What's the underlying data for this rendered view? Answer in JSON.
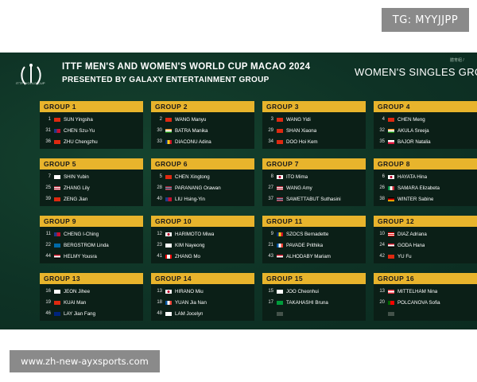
{
  "watermark": {
    "tg": "TG: MYYJJPP",
    "url": "www.zh-new-ayxsports.com"
  },
  "header": {
    "logo_text": "ITTF WORLD CUP",
    "title_line1": "ITTF MEN'S AND WOMEN'S WORLD CUP MACAO 2024",
    "title_line2": "PRESENTED BY GALAXY ENTERTAINMENT GROUP",
    "event_title": "WOMEN'S SINGLES GRO",
    "small_tag": "體育組 / "
  },
  "colors": {
    "header_gold": "#e8b42c",
    "background": "#0f3528",
    "panel": "#0b1f17"
  },
  "groups": [
    {
      "label": "GROUP 1",
      "players": [
        {
          "seed": "1",
          "flag": "china-flag",
          "name": "SUN Yingsha"
        },
        {
          "seed": "31",
          "flag": "chinese-taipei-flag",
          "name": "CHEN Szu-Yu"
        },
        {
          "seed": "36",
          "flag": "china-flag",
          "name": "ZHU Chengzhu"
        }
      ]
    },
    {
      "label": "GROUP 2",
      "players": [
        {
          "seed": "2",
          "flag": "china-flag",
          "name": "WANG Manyu"
        },
        {
          "seed": "30",
          "flag": "india-flag",
          "name": "BATRA Manika"
        },
        {
          "seed": "33",
          "flag": "romania-flag",
          "name": "DIACONU Adina"
        }
      ]
    },
    {
      "label": "GROUP 3",
      "players": [
        {
          "seed": "3",
          "flag": "china-flag",
          "name": "WANG Yidi"
        },
        {
          "seed": "29",
          "flag": "china-flag",
          "name": "SHAN Xiaona"
        },
        {
          "seed": "34",
          "flag": "hong-kong-flag",
          "name": "DOO Hoi Kem"
        }
      ]
    },
    {
      "label": "GROUP 4",
      "players": [
        {
          "seed": "4",
          "flag": "china-flag",
          "name": "CHEN Meng"
        },
        {
          "seed": "32",
          "flag": "india-flag",
          "name": "AKULA Sreeja"
        },
        {
          "seed": "35",
          "flag": "poland-flag",
          "name": "BAJOR Natalia"
        }
      ]
    },
    {
      "label": "GROUP 5",
      "players": [
        {
          "seed": "7",
          "flag": "korea-flag",
          "name": "SHIN Yubin"
        },
        {
          "seed": "25",
          "flag": "usa-flag",
          "name": "ZHANG Lily"
        },
        {
          "seed": "39",
          "flag": "china-flag",
          "name": "ZENG Jian"
        }
      ]
    },
    {
      "label": "GROUP 6",
      "players": [
        {
          "seed": "5",
          "flag": "china-flag",
          "name": "CHEN Xingtong"
        },
        {
          "seed": "28",
          "flag": "thailand-flag",
          "name": "PARANANG Orawan"
        },
        {
          "seed": "40",
          "flag": "chinese-taipei-flag",
          "name": "LIU Hsing-Yin"
        }
      ]
    },
    {
      "label": "GROUP 7",
      "players": [
        {
          "seed": "8",
          "flag": "japan-flag",
          "name": "ITO Mima"
        },
        {
          "seed": "27",
          "flag": "usa-flag",
          "name": "WANG Amy"
        },
        {
          "seed": "37",
          "flag": "thailand-flag",
          "name": "SAWETTABUT Suthasini"
        }
      ]
    },
    {
      "label": "GROUP 8",
      "players": [
        {
          "seed": "6",
          "flag": "japan-flag",
          "name": "HAYATA Hina"
        },
        {
          "seed": "26",
          "flag": "italy-flag",
          "name": "SAMARA Elizabeta"
        },
        {
          "seed": "38",
          "flag": "germany-flag",
          "name": "WINTER Sabine"
        }
      ]
    },
    {
      "label": "GROUP 9",
      "players": [
        {
          "seed": "11",
          "flag": "chinese-taipei-flag",
          "name": "CHENG I-Ching"
        },
        {
          "seed": "22",
          "flag": "sweden-flag",
          "name": "BERGSTROM Linda"
        },
        {
          "seed": "44",
          "flag": "egypt-flag",
          "name": "HELMY Yousra"
        }
      ]
    },
    {
      "label": "GROUP 10",
      "players": [
        {
          "seed": "12",
          "flag": "japan-flag",
          "name": "HARIMOTO Miwa"
        },
        {
          "seed": "23",
          "flag": "korea-flag",
          "name": "KIM Nayeong"
        },
        {
          "seed": "41",
          "flag": "canada-flag",
          "name": "ZHANG Mo"
        }
      ]
    },
    {
      "label": "GROUP 11",
      "players": [
        {
          "seed": "9",
          "flag": "romania-flag",
          "name": "SZOCS Bernadette"
        },
        {
          "seed": "21",
          "flag": "france-flag",
          "name": "PAVADE Prithika"
        },
        {
          "seed": "43",
          "flag": "egypt-flag",
          "name": "ALHODABY Mariam"
        }
      ]
    },
    {
      "label": "GROUP 12",
      "players": [
        {
          "seed": "10",
          "flag": "puerto-rico-flag",
          "name": "DIAZ Adriana"
        },
        {
          "seed": "24",
          "flag": "egypt-flag",
          "name": "GODA Hana"
        },
        {
          "seed": "42",
          "flag": "china-flag",
          "name": "YU Fu"
        }
      ]
    },
    {
      "label": "GROUP 13",
      "players": [
        {
          "seed": "16",
          "flag": "korea-flag",
          "name": "JEON Jihee"
        },
        {
          "seed": "19",
          "flag": "china-flag",
          "name": "KUAI Man"
        },
        {
          "seed": "46",
          "flag": "australia-flag",
          "name": "LAY Jian Fang"
        }
      ]
    },
    {
      "label": "GROUP 14",
      "players": [
        {
          "seed": "13",
          "flag": "japan-flag",
          "name": "HIRANO Miu"
        },
        {
          "seed": "18",
          "flag": "france-flag",
          "name": "YUAN Jia Nan"
        },
        {
          "seed": "48",
          "flag": "korea-flag",
          "name": "LAM Jocelyn"
        }
      ]
    },
    {
      "label": "GROUP 15",
      "players": [
        {
          "seed": "15",
          "flag": "korea-flag",
          "name": "JOO Cheonhui"
        },
        {
          "seed": "17",
          "flag": "brazil-flag",
          "name": "TAKAHASHI Bruna"
        },
        {
          "seed": "",
          "flag": "blurred-flag",
          "name": ""
        }
      ]
    },
    {
      "label": "GROUP 16",
      "players": [
        {
          "seed": "13",
          "flag": "austria-flag",
          "name": "MITTELHAM Nina"
        },
        {
          "seed": "20",
          "flag": "portugal-flag",
          "name": "POLCANOVA Sofia"
        },
        {
          "seed": "",
          "flag": "blurred-flag",
          "name": ""
        }
      ]
    }
  ]
}
